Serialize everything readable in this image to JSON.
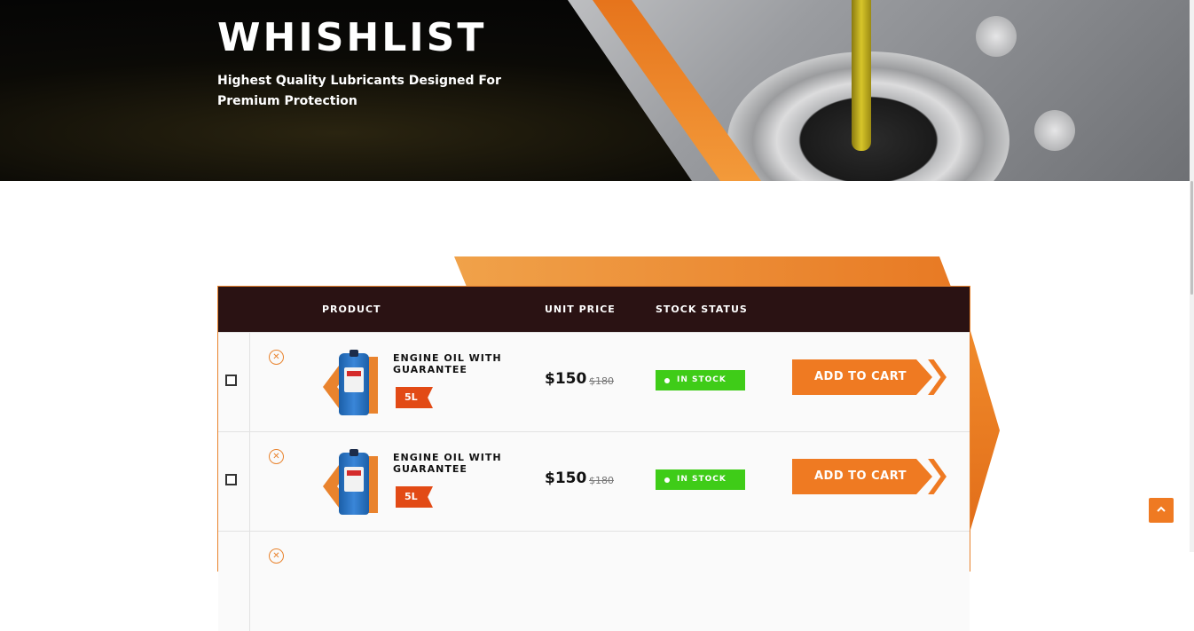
{
  "hero": {
    "title": "WHISHLIST",
    "subtitle": "Highest Quality Lubricants Designed For Premium Protection"
  },
  "table": {
    "headers": {
      "product": "PRODUCT",
      "unit_price": "UNIT PRICE",
      "stock_status": "STOCK STATUS"
    },
    "rows": [
      {
        "remove_icon": "close-icon",
        "name": "ENGINE OIL WITH GUARANTEE",
        "size": "5L",
        "price": "$150",
        "old_price": "$180",
        "stock": "IN STOCK",
        "cart_label": "ADD TO CART"
      },
      {
        "remove_icon": "close-icon",
        "name": "ENGINE OIL WITH GUARANTEE",
        "size": "5L",
        "price": "$150",
        "old_price": "$180",
        "stock": "IN STOCK",
        "cart_label": "ADD TO CART"
      }
    ]
  },
  "colors": {
    "accent": "#ef7a22",
    "header_bg": "#2a1213",
    "in_stock": "#3fcc18",
    "badge": "#e24a15"
  },
  "back_to_top_icon": "chevron-up-icon"
}
